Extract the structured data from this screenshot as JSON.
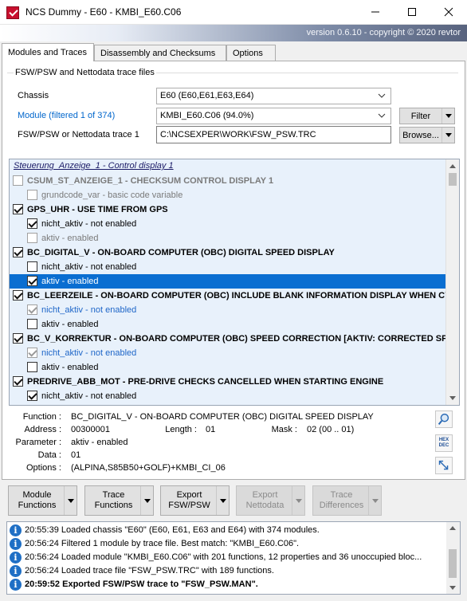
{
  "window": {
    "title": "NCS Dummy  -  E60  -  KMBI_E60.C06",
    "version": "version 0.6.10 - copyright © 2020 revtor"
  },
  "tabs": [
    {
      "label": "Modules and Traces",
      "active": true
    },
    {
      "label": "Disassembly and Checksums",
      "active": false
    },
    {
      "label": "Options",
      "active": false
    }
  ],
  "files": {
    "group_title": "FSW/PSW and Nettodata trace files",
    "chassis_label": "Chassis",
    "chassis_value": "E60  (E60,E61,E63,E64)",
    "module_label": "Module (filtered 1 of 374)",
    "module_value": "KMBI_E60.C06  (94.0%)",
    "trace_label": "FSW/PSW or Nettodata trace 1",
    "trace_value": "C:\\NCSEXPER\\WORK\\FSW_PSW.TRC",
    "filter_label": "Filter",
    "browse_label": "Browse..."
  },
  "tree": {
    "section": "Steuerung_Anzeige_1  -  Control display 1",
    "rows": [
      {
        "level": 0,
        "checked": false,
        "disabled": true,
        "bold": true,
        "selected": false,
        "color": "grey",
        "text": "CSUM_ST_ANZEIGE_1  -  CHECKSUM CONTROL DISPLAY 1"
      },
      {
        "level": 1,
        "checked": false,
        "disabled": true,
        "bold": false,
        "selected": false,
        "color": "grey",
        "text": "grundcode_var  -  basic code variable"
      },
      {
        "level": 0,
        "checked": true,
        "disabled": false,
        "bold": true,
        "selected": false,
        "color": "normal",
        "text": "GPS_UHR  -  USE TIME FROM GPS"
      },
      {
        "level": 1,
        "checked": true,
        "disabled": false,
        "bold": false,
        "selected": false,
        "color": "normal",
        "text": "nicht_aktiv  -  not enabled"
      },
      {
        "level": 1,
        "checked": false,
        "disabled": true,
        "bold": false,
        "selected": false,
        "color": "grey",
        "text": "aktiv  -  enabled"
      },
      {
        "level": 0,
        "checked": true,
        "disabled": false,
        "bold": true,
        "selected": false,
        "color": "normal",
        "text": "BC_DIGITAL_V  -  ON-BOARD COMPUTER (OBC) DIGITAL SPEED DISPLAY"
      },
      {
        "level": 1,
        "checked": false,
        "disabled": false,
        "bold": false,
        "selected": false,
        "color": "normal",
        "text": "nicht_aktiv  -  not enabled"
      },
      {
        "level": 1,
        "checked": true,
        "disabled": false,
        "bold": false,
        "selected": true,
        "color": "normal",
        "text": "aktiv  -  enabled"
      },
      {
        "level": 0,
        "checked": true,
        "disabled": false,
        "bold": true,
        "selected": false,
        "color": "normal",
        "text": "BC_LEERZEILE  -  ON-BOARD COMPUTER (OBC) INCLUDE BLANK INFORMATION DISPLAY WHEN CYCL"
      },
      {
        "level": 1,
        "checked": true,
        "disabled": true,
        "bold": false,
        "selected": false,
        "color": "blue",
        "text": "nicht_aktiv  -  not enabled"
      },
      {
        "level": 1,
        "checked": false,
        "disabled": false,
        "bold": false,
        "selected": false,
        "color": "normal",
        "text": "aktiv  -  enabled"
      },
      {
        "level": 0,
        "checked": true,
        "disabled": false,
        "bold": true,
        "selected": false,
        "color": "normal",
        "text": "BC_V_KORREKTUR  -  ON-BOARD COMPUTER (OBC) SPEED CORRECTION [AKTIV: CORRECTED SPEED, N"
      },
      {
        "level": 1,
        "checked": true,
        "disabled": true,
        "bold": false,
        "selected": false,
        "color": "blue",
        "text": "nicht_aktiv  -  not enabled"
      },
      {
        "level": 1,
        "checked": false,
        "disabled": false,
        "bold": false,
        "selected": false,
        "color": "normal",
        "text": "aktiv  -  enabled"
      },
      {
        "level": 0,
        "checked": true,
        "disabled": false,
        "bold": true,
        "selected": false,
        "color": "normal",
        "text": "PREDRIVE_ABB_MOT  -  PRE-DRIVE CHECKS CANCELLED WHEN STARTING ENGINE"
      },
      {
        "level": 1,
        "checked": true,
        "disabled": false,
        "bold": false,
        "selected": false,
        "color": "normal",
        "text": "nicht_aktiv  -  not enabled"
      }
    ]
  },
  "details": {
    "function_key": "Function :",
    "function_val": "BC_DIGITAL_V  -  ON-BOARD COMPUTER (OBC) DIGITAL SPEED DISPLAY",
    "address_key": "Address :",
    "address_val": "00300001",
    "length_key": "Length :",
    "length_val": "01",
    "mask_key": "Mask :",
    "mask_val": "02  (00 .. 01)",
    "parameter_key": "Parameter :",
    "parameter_val": "aktiv  -  enabled",
    "data_key": "Data :",
    "data_val": "01",
    "options_key": "Options :",
    "options_val": "(ALPINA,S85B50+GOLF)+KMBI_CI_06",
    "hexdec_top": "HEX",
    "hexdec_bottom": "DEC",
    "icons": [
      "magnifier-icon",
      "hex-dec-icon",
      "expand-icon"
    ]
  },
  "toolbar": [
    {
      "line1": "Module",
      "line2": "Functions",
      "enabled": true
    },
    {
      "line1": "Trace",
      "line2": "Functions",
      "enabled": true
    },
    {
      "line1": "Export",
      "line2": "FSW/PSW",
      "enabled": true
    },
    {
      "line1": "Export",
      "line2": "Nettodata",
      "enabled": false
    },
    {
      "line1": "Trace",
      "line2": "Differences",
      "enabled": false
    }
  ],
  "log": [
    {
      "time": "20:55:39",
      "msg": "Loaded chassis \"E60\" (E60, E61, E63 and E64) with 374 modules.",
      "bold": false
    },
    {
      "time": "20:56:24",
      "msg": "Filtered 1 module by trace file. Best match: \"KMBI_E60.C06\".",
      "bold": false
    },
    {
      "time": "20:56:24",
      "msg": "Loaded module \"KMBI_E60.C06\" with 201 functions, 12 properties and 36 unoccupied bloc...",
      "bold": false
    },
    {
      "time": "20:56:24",
      "msg": "Loaded trace file \"FSW_PSW.TRC\" with 189 functions.",
      "bold": false
    },
    {
      "time": "20:59:52",
      "msg": "Exported FSW/PSW trace to \"FSW_PSW.MAN\".",
      "bold": true
    }
  ]
}
